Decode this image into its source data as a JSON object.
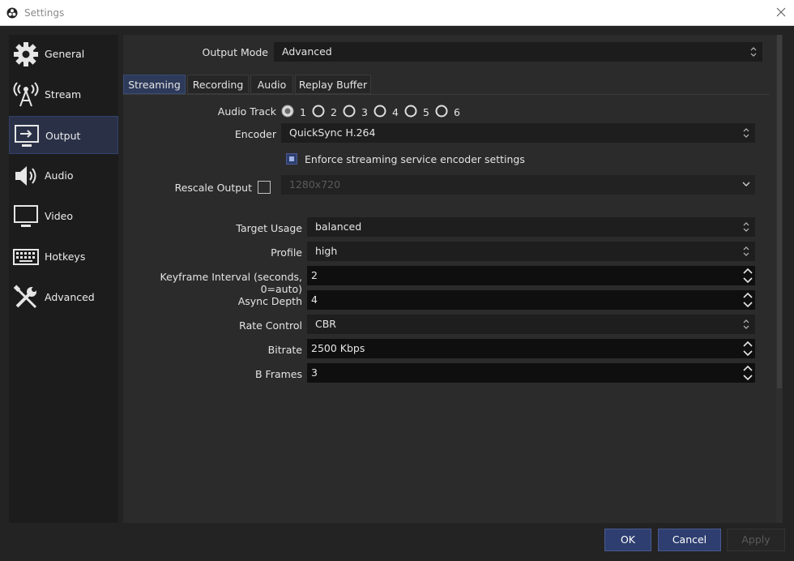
{
  "window": {
    "title": "Settings"
  },
  "sidebar": {
    "items": [
      {
        "label": "General",
        "icon": "gear-icon"
      },
      {
        "label": "Stream",
        "icon": "antenna-icon"
      },
      {
        "label": "Output",
        "icon": "monitor-output-icon",
        "active": true
      },
      {
        "label": "Audio",
        "icon": "speaker-icon"
      },
      {
        "label": "Video",
        "icon": "monitor-icon"
      },
      {
        "label": "Hotkeys",
        "icon": "keyboard-icon"
      },
      {
        "label": "Advanced",
        "icon": "tools-icon"
      }
    ]
  },
  "output_mode": {
    "label": "Output Mode",
    "value": "Advanced"
  },
  "tabs": [
    {
      "label": "Streaming",
      "active": true
    },
    {
      "label": "Recording"
    },
    {
      "label": "Audio"
    },
    {
      "label": "Replay Buffer"
    }
  ],
  "streaming": {
    "audio_track": {
      "label": "Audio Track",
      "options": [
        "1",
        "2",
        "3",
        "4",
        "5",
        "6"
      ],
      "selected": "1"
    },
    "encoder": {
      "label": "Encoder",
      "value": "QuickSync H.264"
    },
    "enforce": {
      "label": "Enforce streaming service encoder settings",
      "checked": true
    },
    "rescale": {
      "label": "Rescale Output",
      "checked": false,
      "value": "1280x720"
    },
    "target_usage": {
      "label": "Target Usage",
      "value": "balanced"
    },
    "profile": {
      "label": "Profile",
      "value": "high"
    },
    "keyframe": {
      "label": "Keyframe Interval (seconds, 0=auto)",
      "value": "2"
    },
    "async_depth": {
      "label": "Async Depth",
      "value": "4"
    },
    "rate_control": {
      "label": "Rate Control",
      "value": "CBR"
    },
    "bitrate": {
      "label": "Bitrate",
      "value": "2500 Kbps"
    },
    "bframes": {
      "label": "B Frames",
      "value": "3"
    }
  },
  "footer": {
    "ok": "OK",
    "cancel": "Cancel",
    "apply": "Apply"
  },
  "colors": {
    "accent": "#2e3e70",
    "panel": "#2b2b2b",
    "sidebar": "#1c1c1c"
  }
}
